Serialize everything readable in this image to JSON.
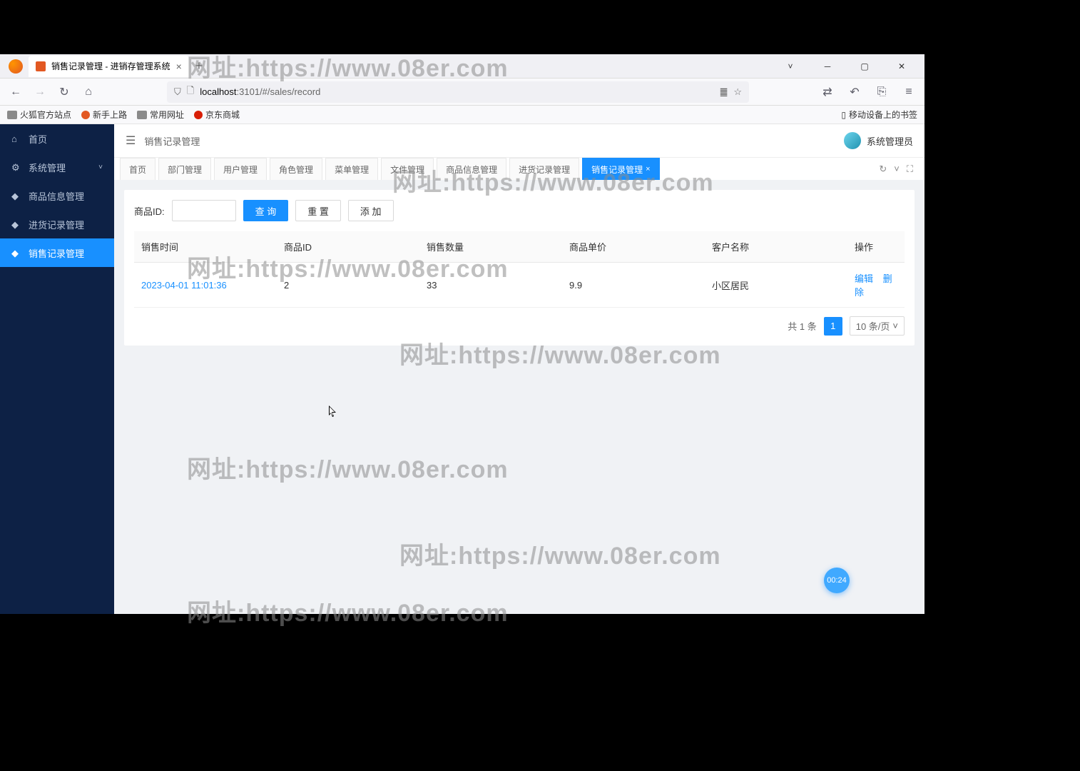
{
  "browser": {
    "tab_title": "销售记录管理 - 进销存管理系统",
    "url_host": "localhost",
    "url_path": ":3101/#/sales/record",
    "bookmarks": [
      "火狐官方站点",
      "新手上路",
      "常用网址",
      "京东商城"
    ],
    "bm_right": "移动设备上的书签"
  },
  "sidebar": {
    "items": [
      {
        "label": "首页"
      },
      {
        "label": "系统管理"
      },
      {
        "label": "商品信息管理"
      },
      {
        "label": "进货记录管理"
      },
      {
        "label": "销售记录管理"
      }
    ]
  },
  "topbar": {
    "breadcrumb": "销售记录管理",
    "username": "系统管理员"
  },
  "tabs": [
    {
      "label": "首页"
    },
    {
      "label": "部门管理"
    },
    {
      "label": "用户管理"
    },
    {
      "label": "角色管理"
    },
    {
      "label": "菜单管理"
    },
    {
      "label": "文件管理"
    },
    {
      "label": "商品信息管理"
    },
    {
      "label": "进货记录管理"
    },
    {
      "label": "销售记录管理"
    }
  ],
  "search": {
    "label": "商品ID:",
    "query_btn": "查 询",
    "reset_btn": "重 置",
    "add_btn": "添 加"
  },
  "table": {
    "headers": [
      "销售时间",
      "商品ID",
      "销售数量",
      "商品单价",
      "客户名称",
      "操作"
    ],
    "rows": [
      {
        "time": "2023-04-01 11:01:36",
        "pid": "2",
        "qty": "33",
        "price": "9.9",
        "customer": "小区居民"
      }
    ],
    "edit": "编辑",
    "delete": "删除"
  },
  "pagination": {
    "total": "共 1 条",
    "page": "1",
    "size": "10 条/页"
  },
  "watermark": "网址:https://www.08er.com",
  "timer": "00:24"
}
